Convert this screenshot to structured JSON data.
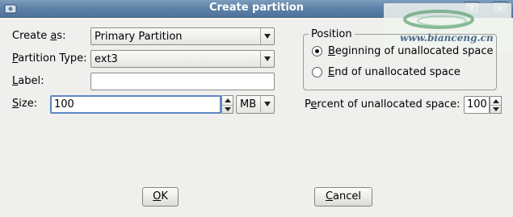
{
  "window": {
    "title": "Create partition"
  },
  "titlebar_buttons": {
    "help": "?",
    "close": "×"
  },
  "watermark": {
    "text": "www.bianceng.cn"
  },
  "form": {
    "create_as": {
      "label_pre": "Create ",
      "label_key": "a",
      "label_post": "s:",
      "value": "Primary Partition"
    },
    "partition_type": {
      "label_key": "P",
      "label_post": "artition Type:",
      "value": "ext3"
    },
    "label": {
      "label_key": "L",
      "label_post": "abel:",
      "value": ""
    },
    "size": {
      "label_key": "S",
      "label_post": "ize:",
      "value": "100",
      "unit": "MB"
    }
  },
  "position": {
    "legend": "Position",
    "options": [
      {
        "key": "B",
        "rest": "eginning of unallocated space",
        "selected": true
      },
      {
        "key": "E",
        "rest": "nd of unallocated space",
        "selected": false
      }
    ]
  },
  "percent": {
    "label_pre": "P",
    "label_key": "e",
    "label_post": "rcent of unallocated space:",
    "value": "100"
  },
  "buttons": {
    "ok": {
      "key": "O",
      "rest": "K"
    },
    "cancel": {
      "key": "C",
      "rest": "ancel"
    }
  }
}
